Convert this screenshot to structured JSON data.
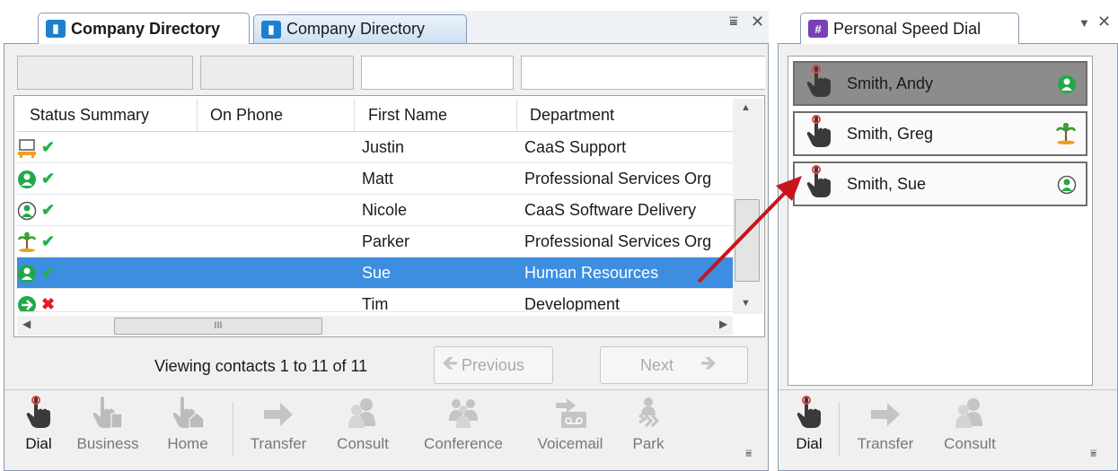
{
  "tabs": {
    "active_label": "Company Directory",
    "inactive_label": "Company Directory",
    "speed_dial_label": "Personal Speed Dial"
  },
  "columns": [
    "Status Summary",
    "On Phone",
    "First Name",
    "Department"
  ],
  "rows": [
    {
      "status_icon": "workstation-icon",
      "mark": "✔",
      "first_name": "Justin",
      "department": "CaaS Support"
    },
    {
      "status_icon": "available-person-icon",
      "mark": "✔",
      "first_name": "Matt",
      "department": "Professional Services Org"
    },
    {
      "status_icon": "person-outline-icon",
      "mark": "✔",
      "first_name": "Nicole",
      "department": "CaaS Software Delivery"
    },
    {
      "status_icon": "vacation-palm-icon",
      "mark": "✔",
      "first_name": "Parker",
      "department": "Professional Services Org"
    },
    {
      "status_icon": "available-person-icon",
      "mark": "✔",
      "first_name": "Sue",
      "department": "Human Resources",
      "selected": true
    },
    {
      "status_icon": "forward-icon",
      "mark": "✖",
      "first_name": "Tim",
      "department": "Development"
    }
  ],
  "pagination": {
    "summary": "Viewing contacts 1 to 11 of 11",
    "previous": "Previous",
    "next": "Next"
  },
  "toolbar": {
    "dial": "Dial",
    "business": "Business",
    "home": "Home",
    "transfer": "Transfer",
    "consult": "Consult",
    "conference": "Conference",
    "voicemail": "Voicemail",
    "park": "Park"
  },
  "speed_dial": {
    "entries": [
      {
        "name": "Smith, Andy",
        "status_icon": "available-person-icon",
        "selected": true
      },
      {
        "name": "Smith, Greg",
        "status_icon": "vacation-palm-icon"
      },
      {
        "name": "Smith, Sue",
        "status_icon": "person-outline-icon"
      }
    ],
    "toolbar": {
      "dial": "Dial",
      "transfer": "Transfer",
      "consult": "Consult"
    }
  },
  "scroll_glyph": "III",
  "colors": {
    "selection": "#3d8ee0",
    "accent_tab": "#1e7fd0",
    "speed_dial_tab": "#7b3fb8",
    "available": "#22b14c",
    "unavailable": "#e02020",
    "arrow": "#c8141c"
  }
}
